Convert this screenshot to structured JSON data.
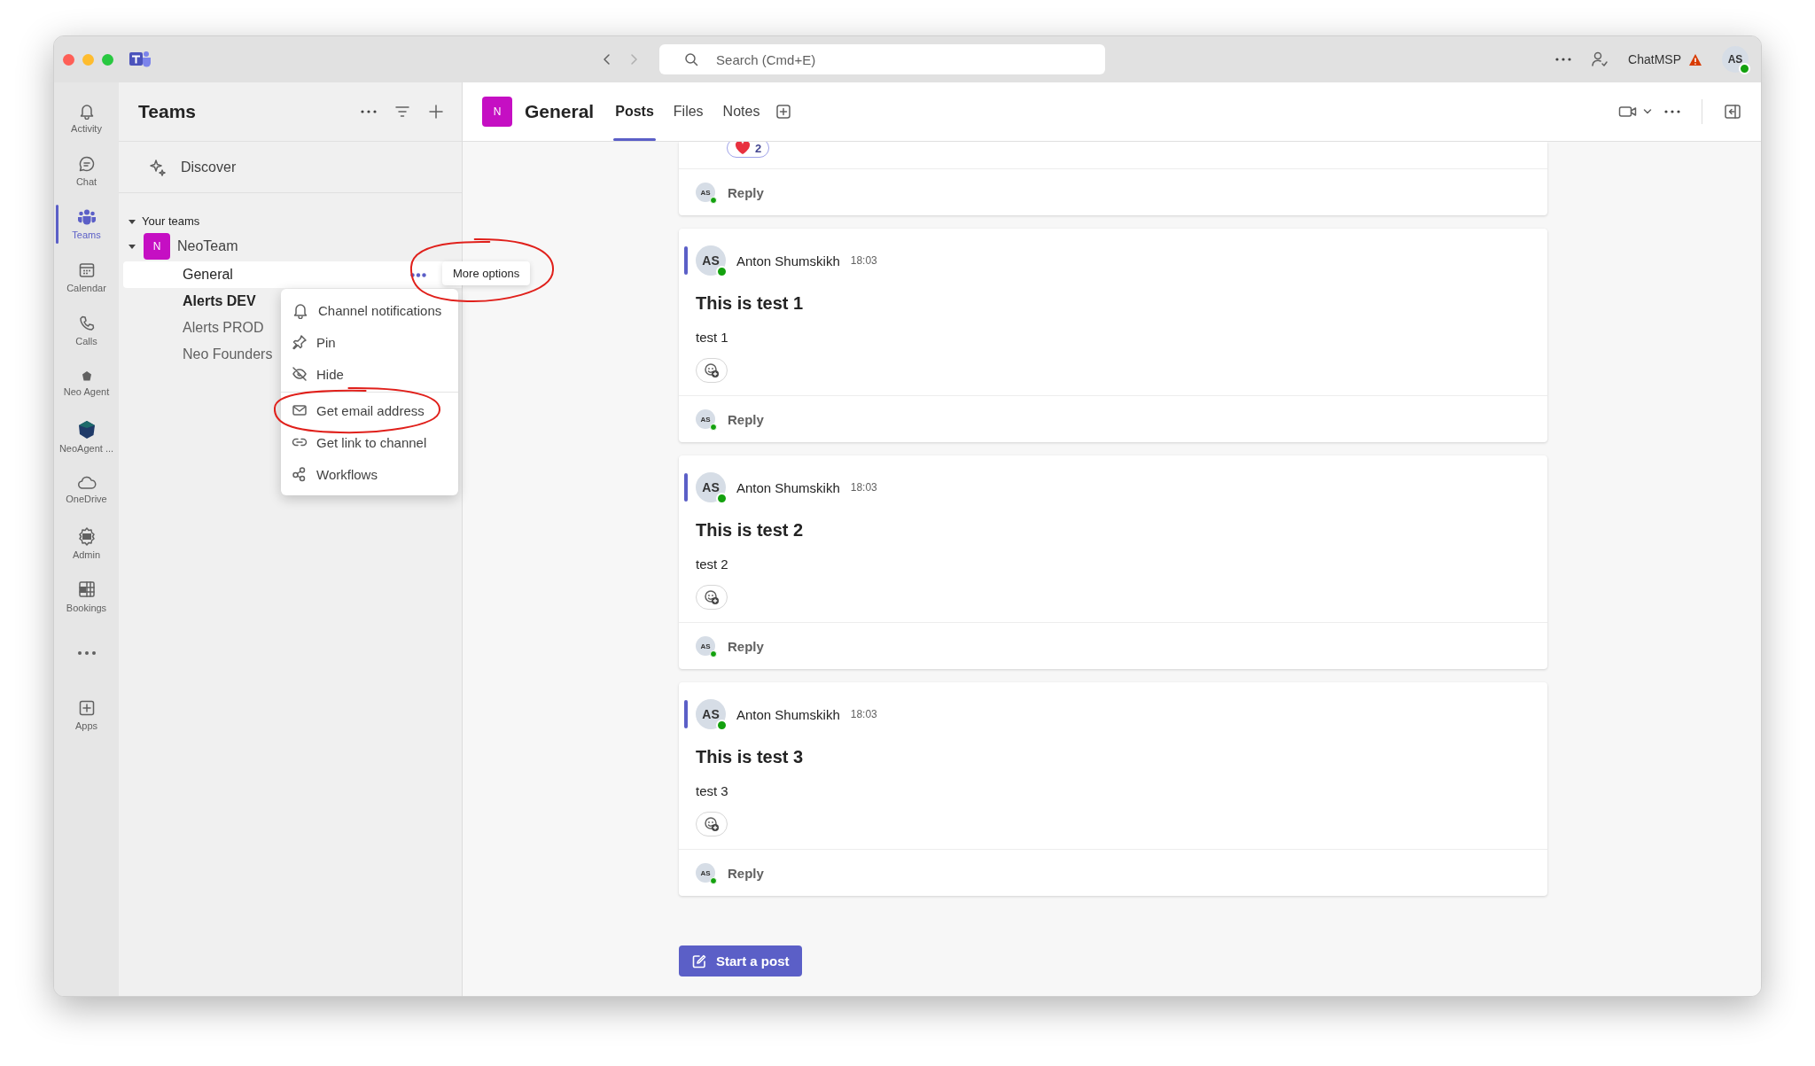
{
  "title_bar": {
    "search": {
      "placeholder": "Search (Cmd+E)"
    },
    "org": "ChatMSP",
    "avatar": "AS"
  },
  "rail": [
    {
      "kind": "bell",
      "label": "Activity",
      "selected": false
    },
    {
      "kind": "chat",
      "label": "Chat",
      "selected": false
    },
    {
      "kind": "teams",
      "label": "Teams",
      "selected": true
    },
    {
      "kind": "calendar",
      "label": "Calendar",
      "selected": false
    },
    {
      "kind": "phone",
      "label": "Calls",
      "selected": false
    },
    {
      "kind": "agent",
      "label": "Neo Agent",
      "selected": false
    },
    {
      "kind": "agent-dark",
      "label": "NeoAgent ...",
      "selected": false
    },
    {
      "kind": "cloud",
      "label": "OneDrive",
      "selected": false
    },
    {
      "kind": "admin",
      "label": "Admin",
      "selected": false
    },
    {
      "kind": "bookings",
      "label": "Bookings",
      "selected": false
    },
    {
      "kind": "more",
      "selected": false
    },
    {
      "kind": "apps",
      "label": "Apps",
      "selected": false
    }
  ],
  "teams_panel": {
    "title": "Teams",
    "discover": "Discover",
    "section": {
      "label": "Your teams",
      "expanded": true
    },
    "teams": [
      {
        "avatar": "N",
        "name": "NeoTeam",
        "expanded": true,
        "channels": [
          {
            "name": "General",
            "selected": true,
            "unread": false
          },
          {
            "name": "Alerts DEV",
            "selected": false,
            "unread": true
          },
          {
            "name": "Alerts PROD",
            "selected": false,
            "unread": false
          },
          {
            "name": "Neo Founders",
            "selected": false,
            "unread": false
          }
        ]
      }
    ]
  },
  "tooltip": {
    "text": "More options",
    "circled": true
  },
  "context_menu": {
    "groups": [
      [
        {
          "kind": "bell",
          "label": "Channel notifications",
          "circled": false
        },
        {
          "kind": "pin",
          "label": "Pin",
          "circled": false
        },
        {
          "kind": "hide",
          "label": "Hide",
          "circled": false
        }
      ],
      [
        {
          "kind": "mail",
          "label": "Get email address",
          "circled": true
        },
        {
          "kind": "link",
          "label": "Get link to channel",
          "circled": false
        },
        {
          "kind": "workflow",
          "label": "Workflows",
          "circled": false
        }
      ]
    ]
  },
  "channel_header": {
    "avatar": "N",
    "title": "General",
    "tabs": [
      {
        "label": "Posts",
        "selected": true
      },
      {
        "label": "Files",
        "selected": false
      },
      {
        "label": "Notes",
        "selected": false
      }
    ]
  },
  "partial_post": {
    "reaction_count": "2",
    "reply": "Reply",
    "reply_avatar": "AS"
  },
  "posts": [
    {
      "avatar": "AS",
      "author": "Anton Shumskikh",
      "time": "18:03",
      "title": "This is test 1",
      "body": "test 1",
      "reply": "Reply",
      "reply_avatar": "AS"
    },
    {
      "avatar": "AS",
      "author": "Anton Shumskikh",
      "time": "18:03",
      "title": "This is test 2",
      "body": "test 2",
      "reply": "Reply",
      "reply_avatar": "AS"
    },
    {
      "avatar": "AS",
      "author": "Anton Shumskikh",
      "time": "18:03",
      "title": "This is test 3",
      "body": "test 3",
      "reply": "Reply",
      "reply_avatar": "AS"
    }
  ],
  "start_post": "Start a post"
}
